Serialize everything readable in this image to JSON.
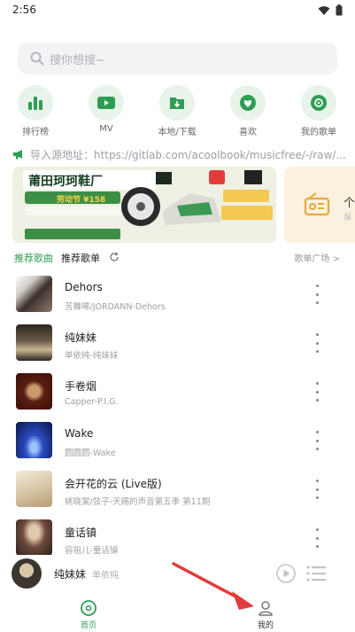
{
  "status_bar": {
    "time": "2:56"
  },
  "search": {
    "placeholder": "搜你想搜~"
  },
  "quick_actions": [
    {
      "label": "排行榜",
      "icon": "bar-chart-icon"
    },
    {
      "label": "MV",
      "icon": "video-icon"
    },
    {
      "label": "本地/下载",
      "icon": "download-folder-icon"
    },
    {
      "label": "喜欢",
      "icon": "heart-icon"
    },
    {
      "label": "我的歌单",
      "icon": "playlist-icon"
    }
  ],
  "notice": {
    "text": "导入源地址：https://gitlab.com/acoolbook/musicfree/-/raw/..."
  },
  "banner": {
    "headline": "莆田珂珂鞋厂",
    "promo": "劳动节 ¥158",
    "right_text": "个",
    "right_subtext": "保"
  },
  "tabs": {
    "recommend_songs": "推荐歌曲",
    "recommend_playlists": "推荐歌单",
    "playlist_square": "歌单广场 >"
  },
  "colors": {
    "accent": "#2e9e55",
    "icon_bg": "#e8f3ea",
    "arrow": "#e23b3b"
  },
  "songs": [
    {
      "title": "Dehors",
      "subtitle": "苦舞唏/JORDANN-Dehors"
    },
    {
      "title": "纯妹妹",
      "subtitle": "单依纯-纯妹妹"
    },
    {
      "title": "手卷烟",
      "subtitle": "Capper-P.I.G."
    },
    {
      "title": "Wake",
      "subtitle": "圆圆圆-Wake"
    },
    {
      "title": "会开花的云 (Live版)",
      "subtitle": "姚晓棠/弦子-天赐的声音第五季 第11期"
    },
    {
      "title": "童话镇",
      "subtitle": "容祖儿-童话镇"
    }
  ],
  "now_playing": {
    "title": "纯妹妹",
    "artist": "单依纯"
  },
  "bottom_nav": [
    {
      "label": "首页",
      "icon": "home-disc-icon",
      "active": true
    },
    {
      "label": "我的",
      "icon": "person-icon",
      "active": false
    }
  ]
}
